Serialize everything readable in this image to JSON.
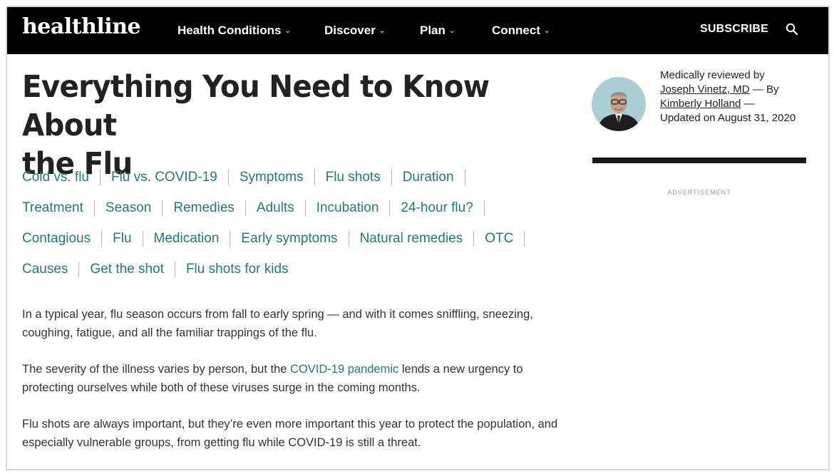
{
  "header": {
    "logo": "healthline",
    "nav": [
      {
        "label": "Health Conditions"
      },
      {
        "label": "Discover"
      },
      {
        "label": "Plan"
      },
      {
        "label": "Connect"
      }
    ],
    "subscribe_label": "SUBSCRIBE",
    "search_icon": "search-icon"
  },
  "article": {
    "title_line1": "Everything You Need to Know About",
    "title_line2": "the Flu",
    "toc": [
      [
        "Cold vs. flu",
        "Flu vs. COVID-19",
        "Symptoms",
        "Flu shots",
        "Duration"
      ],
      [
        "Treatment",
        "Season",
        "Remedies",
        "Adults",
        "Incubation",
        "24-hour flu?"
      ],
      [
        "Contagious",
        "Flu",
        "Medication",
        "Early symptoms",
        "Natural remedies",
        "OTC"
      ],
      [
        "Causes",
        "Get the shot",
        "Flu shots for kids"
      ]
    ],
    "paragraphs": {
      "p1": "In a typical year, flu season occurs from fall to early spring — and with it comes sniffling, sneezing, coughing, fatigue, and all the familiar trappings of the flu.",
      "p2_before": "The severity of the illness varies by person, but the ",
      "p2_link": "COVID-19 pandemic",
      "p2_after": " lends a new urgency to protecting ourselves while both of these viruses surge in the coming months.",
      "p3": "Flu shots are always important, but they’re even more important this year to protect the population, and especially vulnerable groups, from getting flu while COVID-19 is still a threat."
    }
  },
  "sidebar": {
    "reviewed_prefix": "Medically reviewed by",
    "reviewer": "Joseph Vinetz, MD",
    "by_text": " — By",
    "author": "Kimberly Holland",
    "dash": " —",
    "updated": "Updated on August 31, 2020",
    "ad_label": "ADVERTISEMENT"
  },
  "colors": {
    "header_bg": "#000000",
    "link_teal": "#21797d",
    "title": "#222222"
  }
}
